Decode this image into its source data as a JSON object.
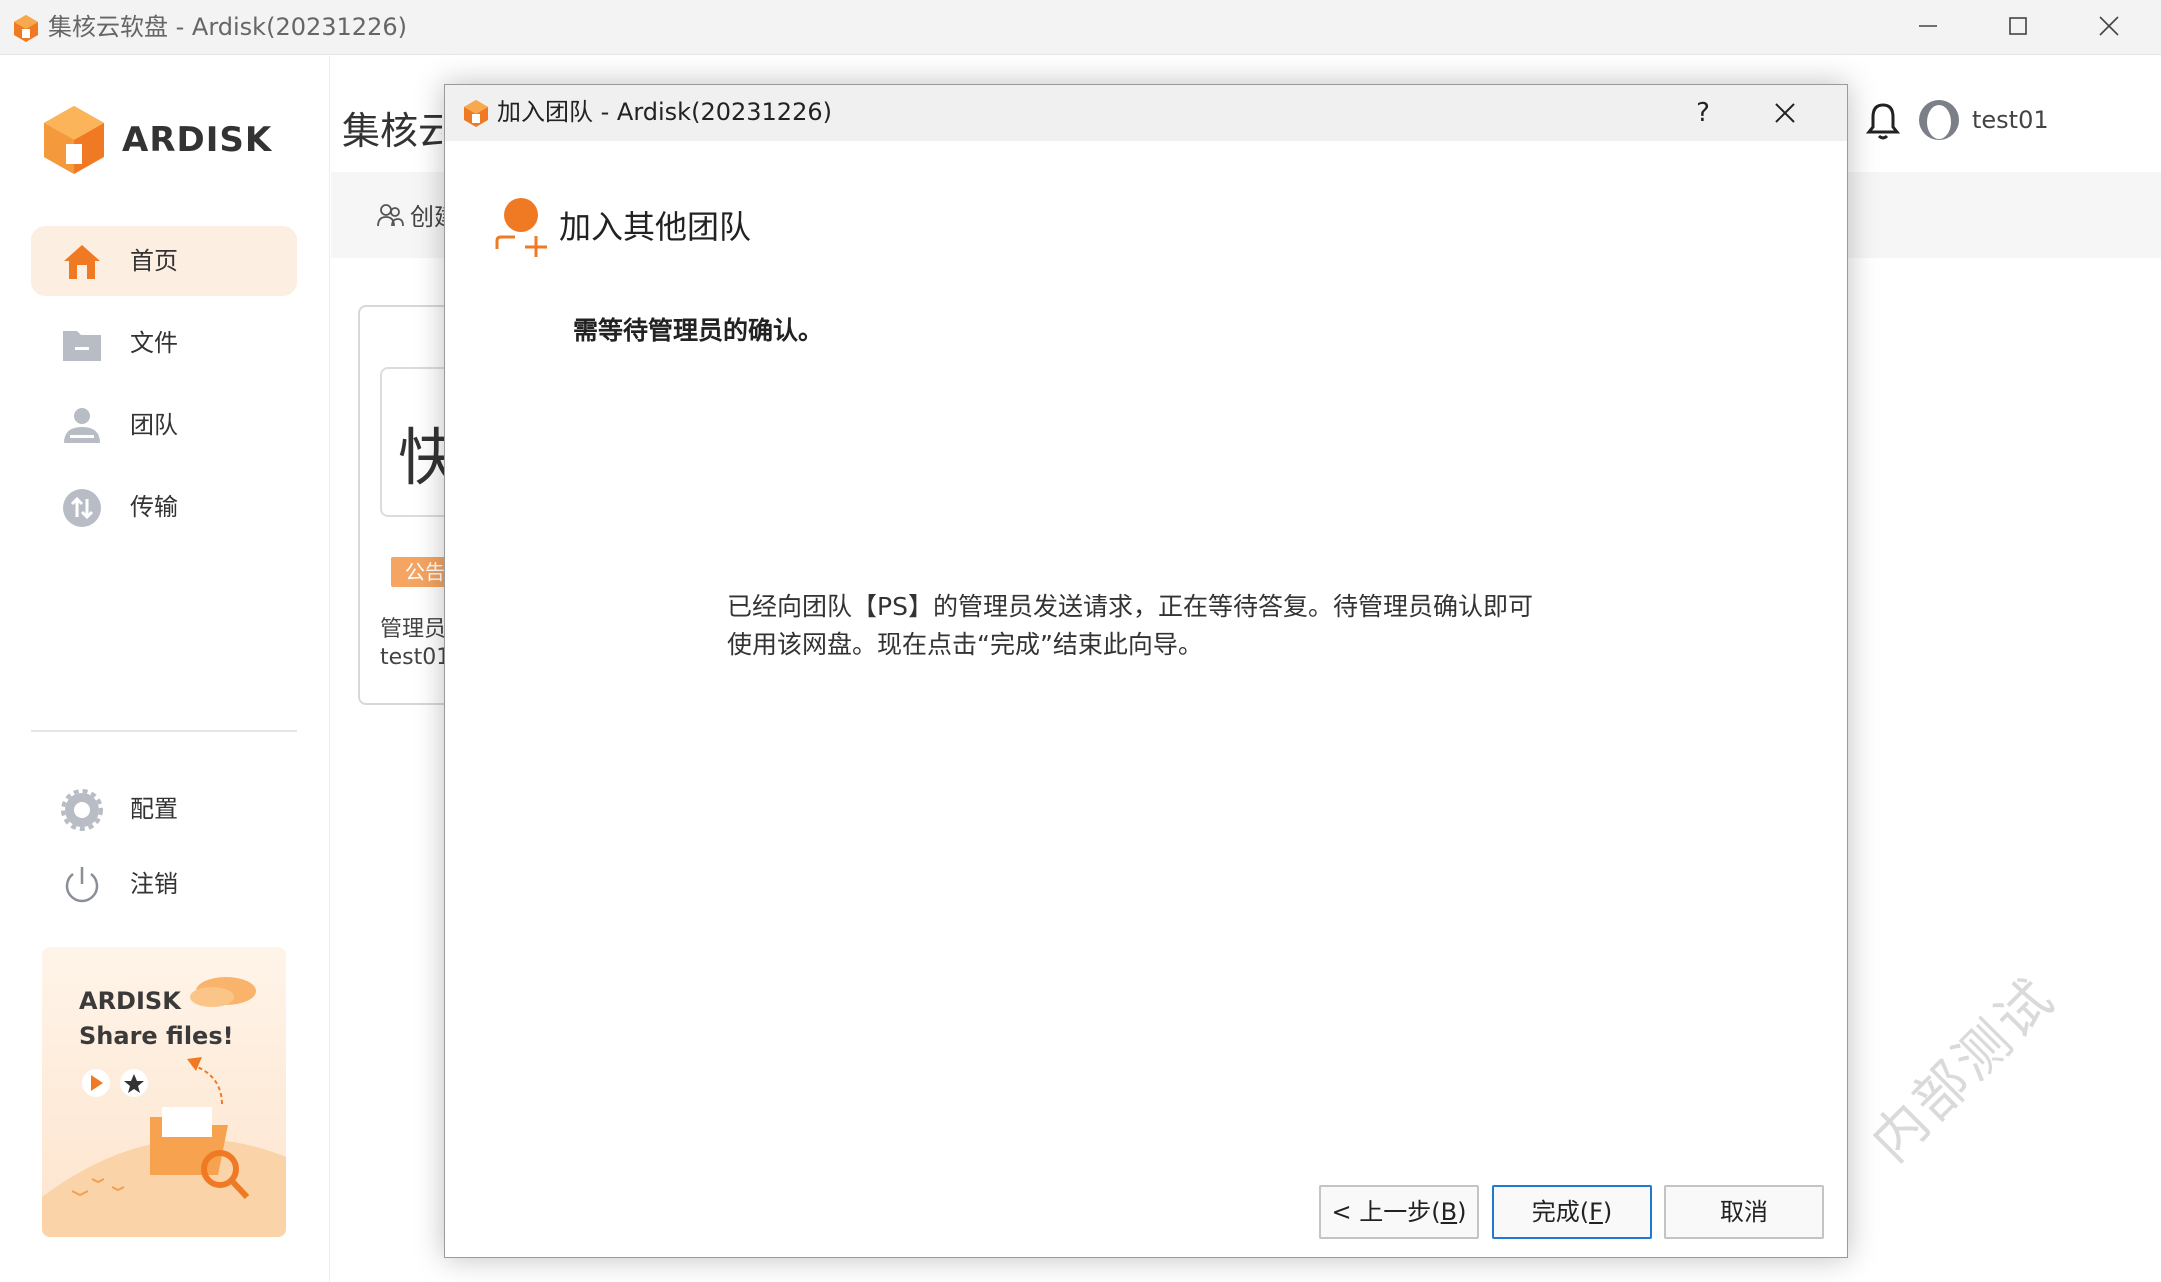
{
  "window": {
    "title": "集核云软盘 - Ardisk(20231226)"
  },
  "sidebar": {
    "brand": "ARDISK",
    "items": [
      {
        "label": "首页"
      },
      {
        "label": "文件"
      },
      {
        "label": "团队"
      },
      {
        "label": "传输"
      }
    ],
    "bottom_items": [
      {
        "label": "配置"
      },
      {
        "label": "注销"
      }
    ],
    "promo": {
      "title": "ARDISK",
      "subtitle": "Share files!"
    }
  },
  "main": {
    "title": "集核云",
    "toolbar": {
      "create_label": "创建"
    },
    "user": {
      "name": "test01"
    },
    "team_card": {
      "quick_char": "快",
      "notice_tag": "公告",
      "admin_label": "管理员",
      "admin_name": "test01"
    },
    "watermark": "内部测试"
  },
  "dialog": {
    "title": "加入团队 - Ardisk(20231226)",
    "help_label": "?",
    "heading": "加入其他团队",
    "subtitle": "需等待管理员的确认。",
    "message_line1": "已经向团队【PS】的管理员发送请求，正在等待答复。待管理员确认即可",
    "message_line2": "使用该网盘。现在点击“完成”结束此向导。",
    "buttons": {
      "back_prefix": "< 上一步(",
      "back_key": "B",
      "back_suffix": ")",
      "finish_prefix": "完成(",
      "finish_key": "F",
      "finish_suffix": ")",
      "cancel": "取消"
    }
  },
  "colors": {
    "accent": "#f07a24",
    "active_nav_bg": "#fdeee2",
    "primary_button_border": "#1f79d1"
  }
}
